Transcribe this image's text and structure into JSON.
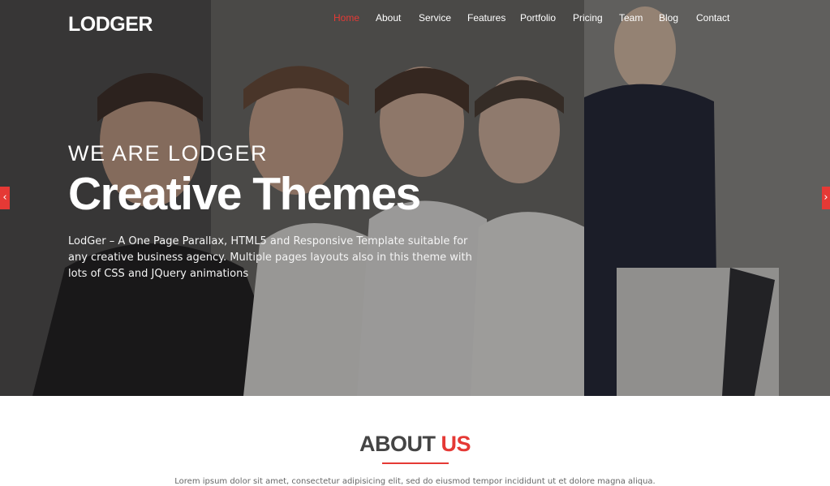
{
  "brand": {
    "logo": "LODGER"
  },
  "nav": {
    "items": [
      {
        "label": "Home",
        "active": true
      },
      {
        "label": "About"
      },
      {
        "label": "Service"
      },
      {
        "label": "Features"
      },
      {
        "label": "Portfolio"
      },
      {
        "label": "Pricing"
      },
      {
        "label": "Team"
      },
      {
        "label": "Blog"
      },
      {
        "label": "Contact"
      }
    ]
  },
  "hero": {
    "eyebrow": "WE ARE LODGER",
    "headline": "Creative Themes",
    "description": "LodGer – A One Page Parallax, HTML5 and Responsive Template suitable for any creative business agency. Multiple pages layouts also in this theme with lots of CSS and JQuery animations",
    "prev_icon": "chevron-left-icon",
    "prev_glyph": "‹",
    "next_icon": "chevron-right-icon",
    "next_glyph": "›"
  },
  "about": {
    "title_part1": "ABOUT",
    "title_part2": "US",
    "text": "Lorem ipsum dolor sit amet, consectetur adipisicing elit, sed do eiusmod tempor incididunt ut et dolore magna aliqua."
  },
  "colors": {
    "accent": "#e53935",
    "title_gray": "#444444"
  }
}
